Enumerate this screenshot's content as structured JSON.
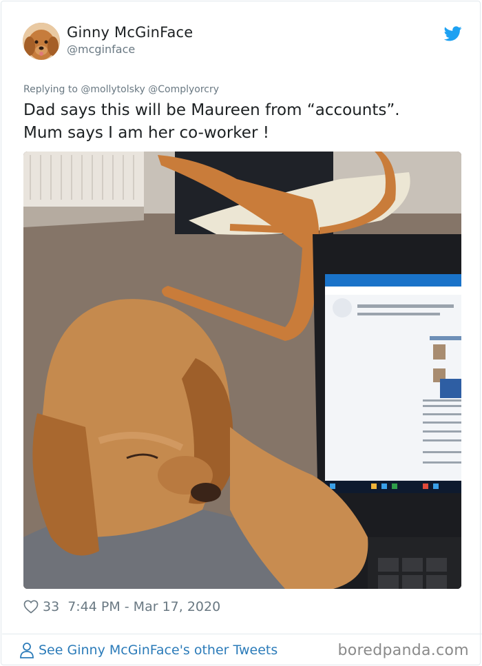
{
  "user": {
    "name": "Ginny McGinFace",
    "handle": "@mcginface"
  },
  "reply": {
    "prefix": "Replying to",
    "mention_1": "@mollytolsky",
    "mention_2": "@Complyorcry"
  },
  "tweet": {
    "line_1": "Dad says this will be Maureen from “accounts”.",
    "line_2": "Mum says I am her co-worker !"
  },
  "photo": {
    "icon": "photo-of-puppy-at-laptop"
  },
  "meta": {
    "likes": "33",
    "timestamp": "7:44 PM - Mar 17, 2020"
  },
  "footer": {
    "other_tweets": "See Ginny McGinFace's other Tweets",
    "brand": "boredpanda.com"
  },
  "colors": {
    "twitter_blue": "#1da1f2",
    "link_blue": "#2b7bb9",
    "muted": "#697882"
  }
}
